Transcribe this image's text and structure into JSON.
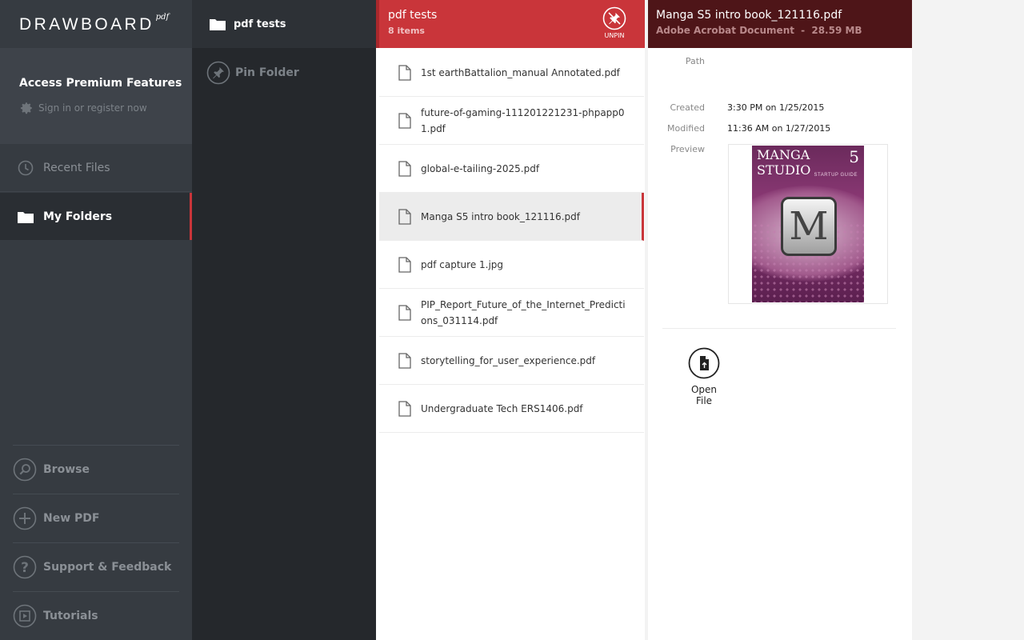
{
  "sidebar": {
    "logo_main": "DRAWBOARD",
    "logo_sub": "pdf",
    "premium_title": "Access Premium Features",
    "premium_sub": "Sign in or register now",
    "nav": [
      {
        "label": "Recent Files",
        "icon": "clock-icon"
      },
      {
        "label": "My Folders",
        "icon": "folder-icon"
      }
    ],
    "bottom": [
      {
        "label": "Browse",
        "icon": "search-icon"
      },
      {
        "label": "New PDF",
        "icon": "plus-icon"
      },
      {
        "label": "Support & Feedback",
        "icon": "question-icon"
      },
      {
        "label": "Tutorials",
        "icon": "play-icon"
      }
    ]
  },
  "folders": {
    "current": "pdf tests",
    "pin_label": "Pin Folder"
  },
  "file_list": {
    "title": "pdf tests",
    "count": "8 items",
    "unpin_label": "UNPIN",
    "files": [
      "1st earthBattalion_manual Annotated.pdf",
      "future-of-gaming-111201221231-phpapp01.pdf",
      "global-e-tailing-2025.pdf",
      "Manga S5 intro book_121116.pdf",
      "pdf capture 1.jpg",
      "PIP_Report_Future_of_the_Internet_Predictions_031114.pdf",
      "storytelling_for_user_experience.pdf",
      "Undergraduate Tech ERS1406.pdf"
    ],
    "selected_index": 3
  },
  "details": {
    "title": "Manga S5 intro book_121116.pdf",
    "type": "Adobe Acrobat Document",
    "separator": "-",
    "size": "28.59 MB",
    "path_label": "Path",
    "path_value": "",
    "created_label": "Created",
    "created_value": "3:30 PM on 1/25/2015",
    "modified_label": "Modified",
    "modified_value": "11:36 AM on 1/27/2015",
    "preview_label": "Preview",
    "cover_title": "MANGA STUDIO",
    "cover_number": "5",
    "cover_subtitle": "STARTUP GUIDE",
    "cover_letter": "M",
    "open_label": "Open File"
  },
  "colors": {
    "accent": "#c9353a",
    "detail_header": "#4e1518",
    "sidebar": "#363b41",
    "folder_panel": "#25282c"
  }
}
